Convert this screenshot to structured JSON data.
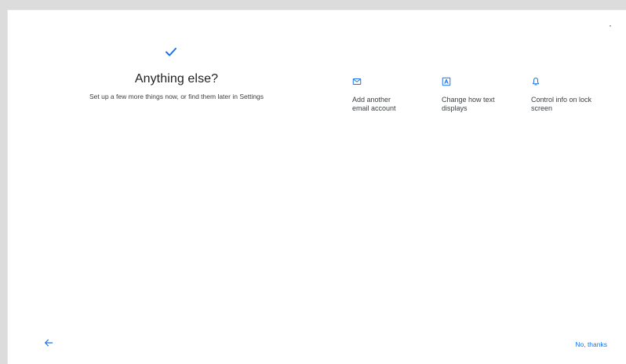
{
  "colors": {
    "accent": "#1a73e8",
    "text_primary": "#202124",
    "text_secondary": "#3c4043",
    "background": "#ffffff"
  },
  "header": {
    "check_icon": "check-icon",
    "title": "Anything else?",
    "subtitle": "Set up a few more things now, or find them later in Settings"
  },
  "options": [
    {
      "icon": "email-icon",
      "label": "Add another email account"
    },
    {
      "icon": "text-display-icon",
      "label": "Change how text displays"
    },
    {
      "icon": "bell-icon",
      "label": "Control info on lock screen"
    }
  ],
  "footer": {
    "back_icon": "back-arrow-icon",
    "skip_label": "No, thanks"
  }
}
